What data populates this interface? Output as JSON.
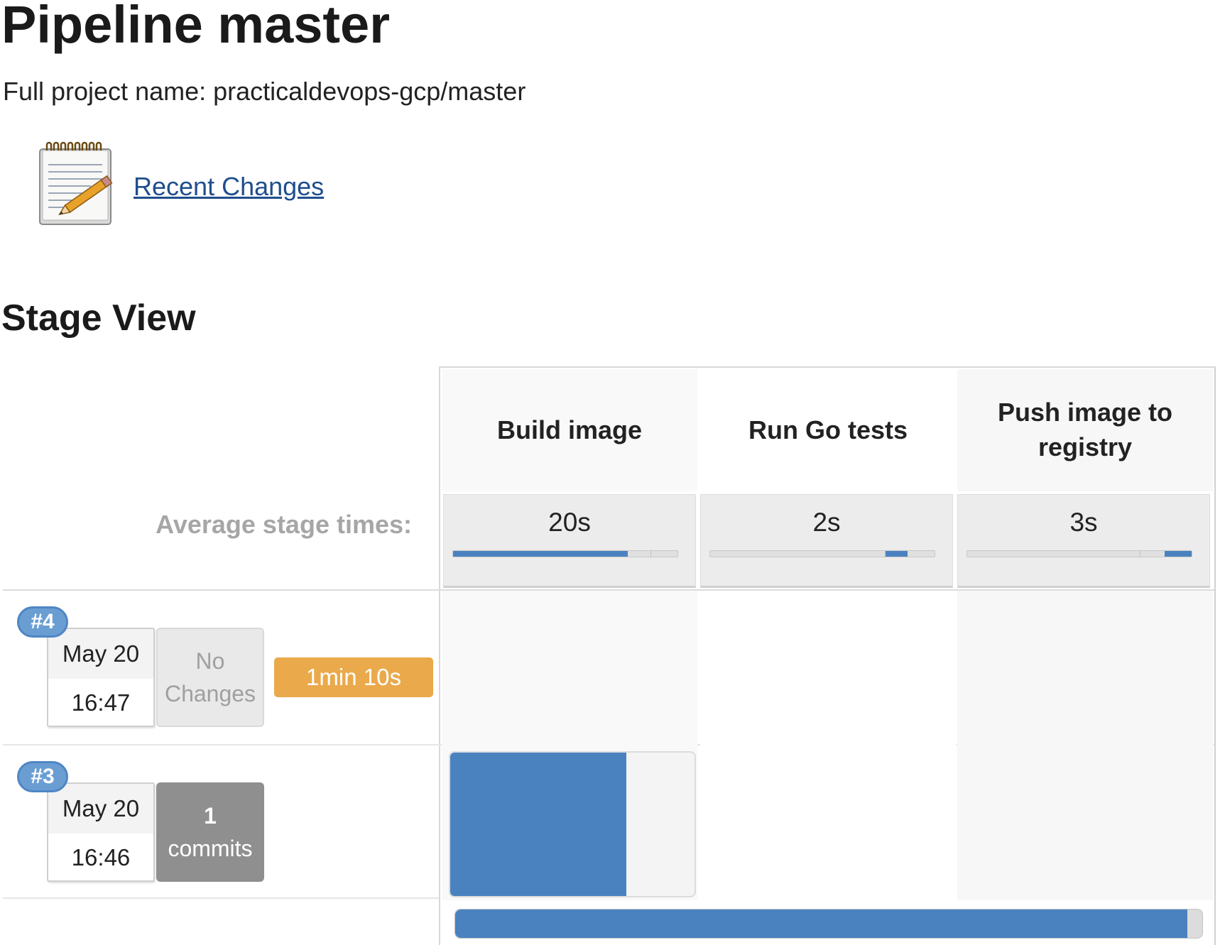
{
  "page": {
    "title": "Pipeline master",
    "full_name_label": "Full project name:",
    "full_name_value": "practicaldevops-gcp/master",
    "recent_changes_label": "Recent Changes",
    "recent_changes_icon": "notepad-pencil-icon"
  },
  "stage_view": {
    "title": "Stage View",
    "average_label": "Average stage times:",
    "stages": [
      {
        "name": "Build image",
        "average": "20s",
        "average_fraction": 0.78
      },
      {
        "name": "Run Go tests",
        "average": "2s",
        "average_fraction": 0.1
      },
      {
        "name": "Push image to registry",
        "average": "3s",
        "average_fraction": 0.12
      }
    ],
    "builds": [
      {
        "badge": "#4",
        "date": "May 20",
        "time": "16:47",
        "changes": "No Changes",
        "duration": "1min 10s"
      },
      {
        "badge": "#3",
        "date": "May 20",
        "time": "16:46",
        "changes_count": "1",
        "changes_unit": "commits",
        "running_stage_progress": 0.72
      }
    ],
    "overall_progress": 0.98,
    "colors": {
      "accent_blue": "#4a82c0",
      "badge_blue": "#6a9ed3",
      "duration_orange": "#eaa94a",
      "commits_gray": "#8f8f8f"
    }
  }
}
